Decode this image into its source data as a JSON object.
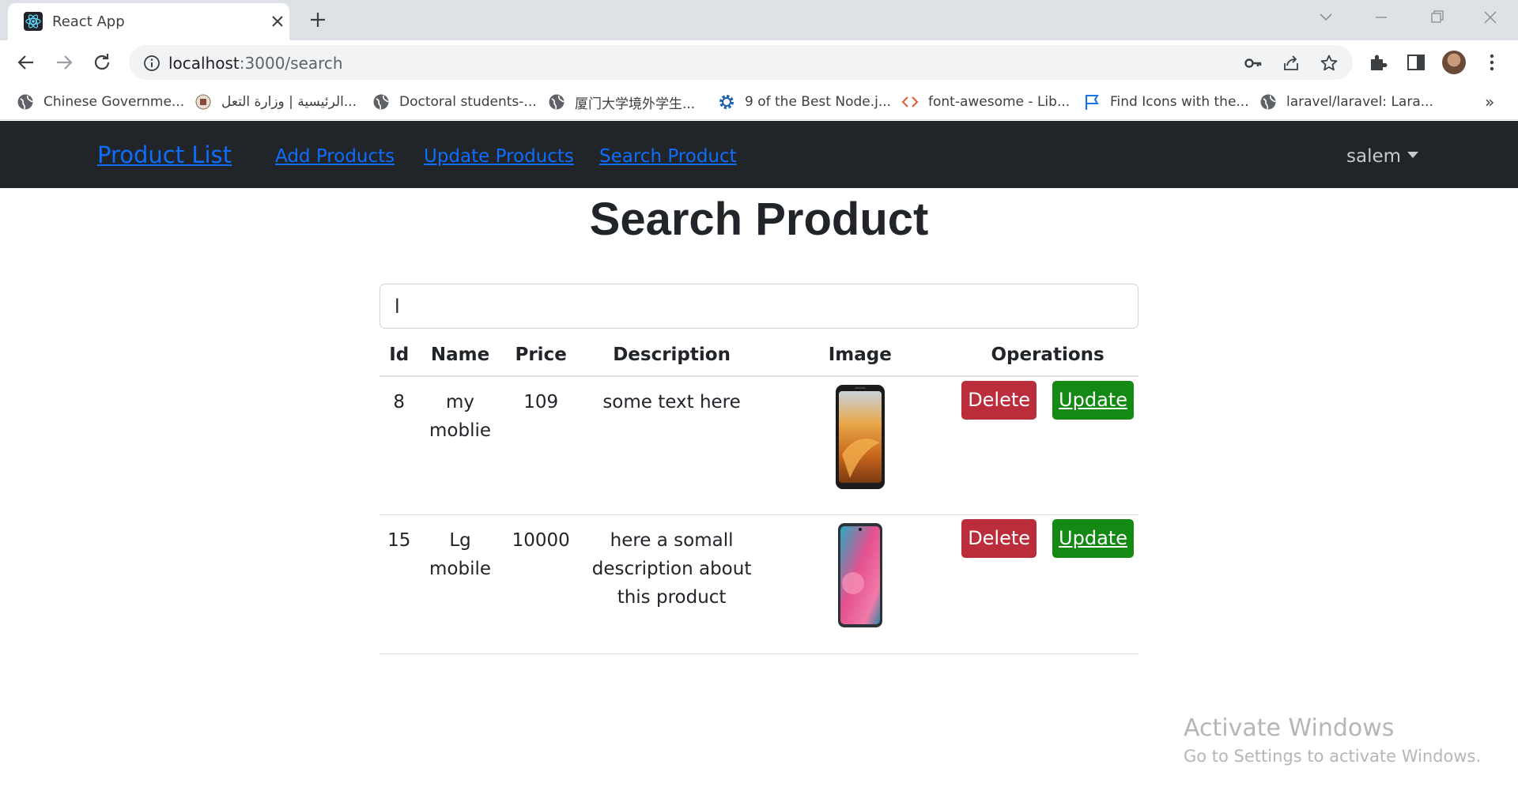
{
  "browser": {
    "tab_title": "React App",
    "url_host": "localhost",
    "url_path": ":3000/search",
    "bookmarks": [
      {
        "label": "Chinese Governme...",
        "icon": "globe-icon"
      },
      {
        "label": "الرئيسية | وزارة التعل...",
        "icon": "ministry-logo-icon"
      },
      {
        "label": "Doctoral students-...",
        "icon": "globe-icon"
      },
      {
        "label": "厦门大学境外学生...",
        "icon": "globe-icon"
      },
      {
        "label": "9 of the Best Node.j...",
        "icon": "gear-icon"
      },
      {
        "label": "font-awesome - Lib...",
        "icon": "code-icon"
      },
      {
        "label": "Find Icons with the...",
        "icon": "flag-icon"
      },
      {
        "label": "laravel/laravel: Lara...",
        "icon": "globe-icon"
      }
    ],
    "bookmarks_more": "»"
  },
  "navbar": {
    "brand": "Product List",
    "links": [
      "Add Products",
      "Update Products",
      "Search Product"
    ],
    "user": "salem"
  },
  "main": {
    "title": "Search Product",
    "search_value": "l",
    "table": {
      "headers": [
        "Id",
        "Name",
        "Price",
        "Description",
        "Image",
        "Operations"
      ],
      "rows": [
        {
          "id": "8",
          "name": "my moblie",
          "price": "109",
          "description": "some text here",
          "image": "phone-dark-icon",
          "delete_label": "Delete",
          "update_label": "Update"
        },
        {
          "id": "15",
          "name": "Lg mobile",
          "price": "10000",
          "description": "here a somall description about this product",
          "image": "phone-pink-icon",
          "delete_label": "Delete",
          "update_label": "Update"
        }
      ]
    }
  },
  "watermark": {
    "line1": "Activate Windows",
    "line2": "Go to Settings to activate Windows."
  },
  "colors": {
    "navbar_bg": "#212529",
    "link": "#0d6efd",
    "delete_btn": "#bb2d3b",
    "update_btn": "#148a14"
  }
}
